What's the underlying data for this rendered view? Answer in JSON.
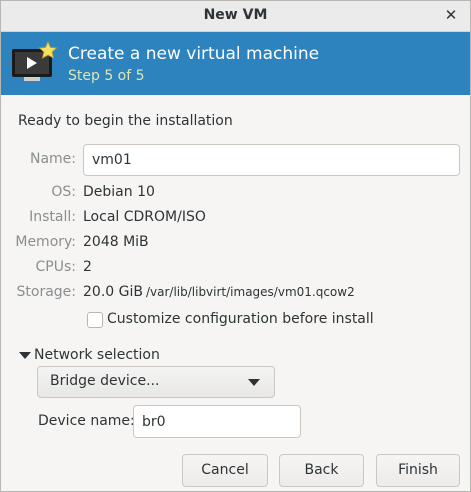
{
  "window": {
    "title": "New VM",
    "close_glyph": "✕"
  },
  "header": {
    "title": "Create a new virtual machine",
    "step": "Step 5 of 5",
    "icon": "vm-monitor-star-icon",
    "background_color": "#2c83bd"
  },
  "summary": {
    "heading": "Ready to begin the installation",
    "name_label": "Name:",
    "name_value": "vm01",
    "os_label": "OS:",
    "os_value": "Debian 10",
    "install_label": "Install:",
    "install_value": "Local CDROM/ISO",
    "memory_label": "Memory:",
    "memory_value": "2048 MiB",
    "cpus_label": "CPUs:",
    "cpus_value": "2",
    "storage_label": "Storage:",
    "storage_value": "20.0 GiB",
    "storage_path": "/var/lib/libvirt/images/vm01.qcow2",
    "customize_label": "Customize configuration before install",
    "customize_checked": false
  },
  "network": {
    "expander_label": "Network selection",
    "expanded": true,
    "source_selected": "Bridge device...",
    "device_name_label": "Device name:",
    "device_name_value": "br0"
  },
  "buttons": {
    "cancel": "Cancel",
    "back": "Back",
    "finish": "Finish"
  }
}
